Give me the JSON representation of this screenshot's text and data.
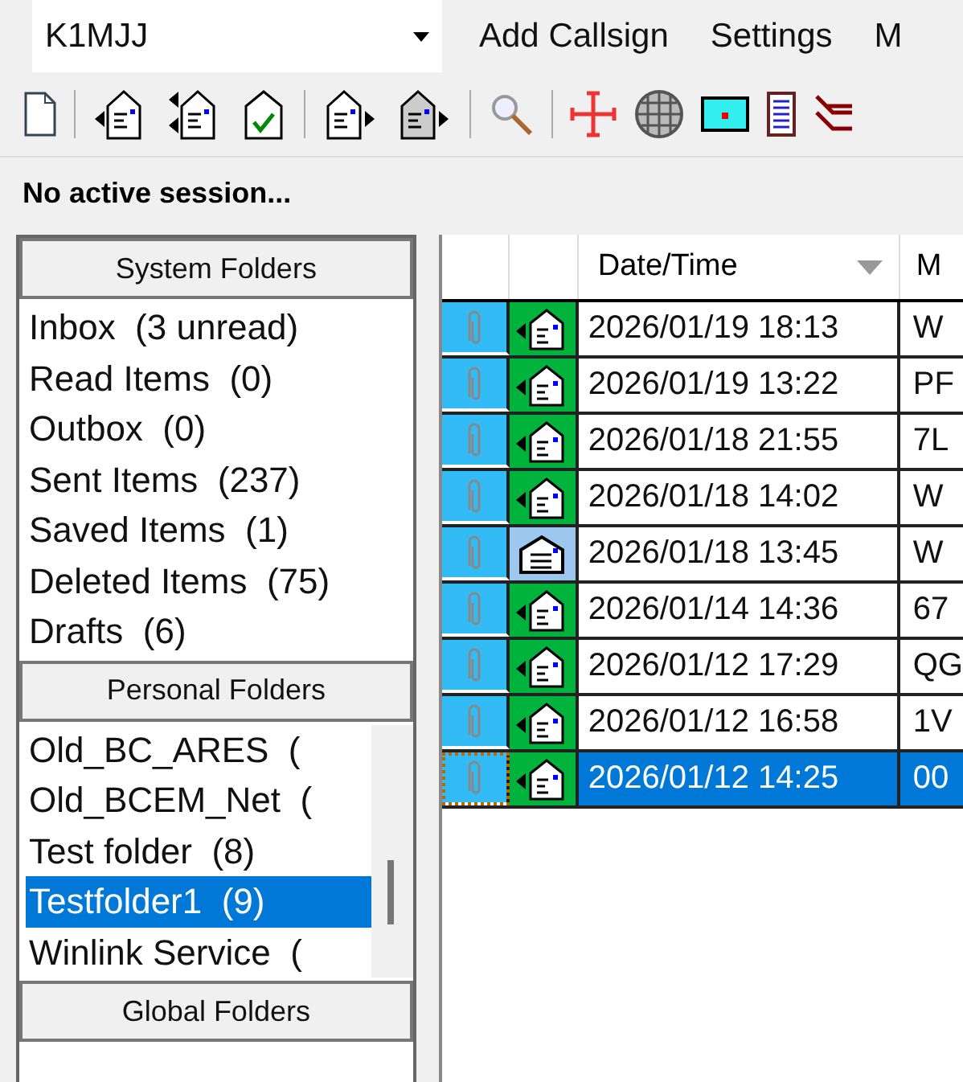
{
  "callsign": {
    "value": "K1MJJ"
  },
  "menu": [
    "Add Callsign",
    "Settings",
    "M"
  ],
  "status": "No active session...",
  "folder_sections": [
    {
      "title": "System Folders",
      "items": [
        {
          "label": "Inbox  (3 unread)",
          "selected": false
        },
        {
          "label": "Read Items  (0)",
          "selected": false
        },
        {
          "label": "Outbox  (0)",
          "selected": false
        },
        {
          "label": "Sent Items  (237)",
          "selected": false
        },
        {
          "label": "Saved Items  (1)",
          "selected": false
        },
        {
          "label": "Deleted Items  (75)",
          "selected": false
        },
        {
          "label": "Drafts  (6)",
          "selected": false
        }
      ]
    },
    {
      "title": "Personal Folders",
      "scrollbar": true,
      "items": [
        {
          "label": "Old_BC_ARES  (",
          "selected": false
        },
        {
          "label": "Old_BCEM_Net  (",
          "selected": false
        },
        {
          "label": "Test folder  (8)",
          "selected": false
        },
        {
          "label": "Testfolder1  (9)",
          "selected": true
        },
        {
          "label": "Winlink Service  (",
          "selected": false
        }
      ]
    },
    {
      "title": "Global Folders"
    }
  ],
  "table": {
    "columns": [
      {
        "label": "Date/Time",
        "sorted": true
      },
      {
        "label": "M"
      }
    ],
    "rows": [
      {
        "kind": "outgoing",
        "date": "2026/01/19 18:13",
        "column_4": "W",
        "selected": false
      },
      {
        "kind": "outgoing",
        "date": "2026/01/19 13:22",
        "column_4": "PF",
        "selected": false
      },
      {
        "kind": "outgoing",
        "date": "2026/01/18 21:55",
        "column_4": "7L",
        "selected": false
      },
      {
        "kind": "outgoing",
        "date": "2026/01/18 14:02",
        "column_4": "W",
        "selected": false
      },
      {
        "kind": "read",
        "date": "2026/01/18 13:45",
        "column_4": "W",
        "selected": false
      },
      {
        "kind": "outgoing",
        "date": "2026/01/14 14:36",
        "column_4": "67",
        "selected": false
      },
      {
        "kind": "outgoing",
        "date": "2026/01/12 17:29",
        "column_4": "QG",
        "selected": false
      },
      {
        "kind": "outgoing",
        "date": "2026/01/12 16:58",
        "column_4": "1V",
        "selected": false
      },
      {
        "kind": "outgoing",
        "date": "2026/01/12 14:25",
        "column_4": "00",
        "selected": true
      }
    ]
  }
}
